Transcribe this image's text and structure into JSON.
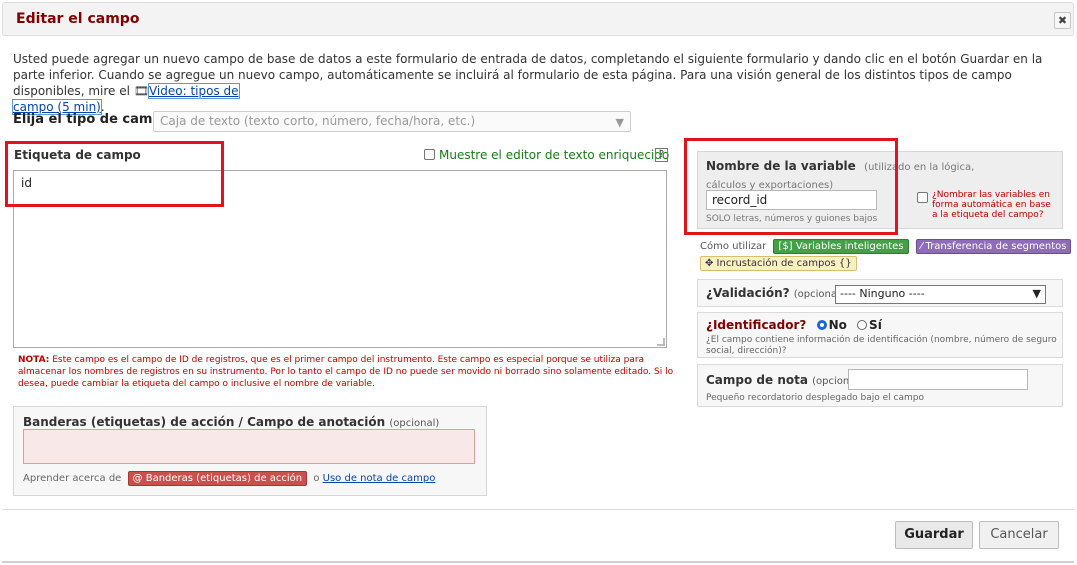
{
  "dialog": {
    "title": "Editar el campo",
    "close": "✖"
  },
  "intro": {
    "text1": "Usted puede agregar un nuevo campo de base de datos a este formulario de entrada de datos, completando el siguiente formulario y dando clic en el botón Guardar en la parte inferior. Cuando se agregue un nuevo campo, automáticamente se incluirá al formulario de esta página. Para una visión general de los distintos tipos de campo disponibles, mire el ",
    "video_link_a": "Video: tipos de",
    "video_link_b": "campo (5 min)",
    "video_icon": "film-icon"
  },
  "field_type": {
    "label": "Elija el tipo de campo",
    "selected": "Caja de texto (texto corto, número, fecha/hora, etc.)"
  },
  "field_label": {
    "label": "Etiqueta de campo",
    "rich_text_toggle": "Muestre el editor de texto enriquecido",
    "help": "?",
    "value": "id"
  },
  "note": {
    "prefix": "NOTA:",
    "text": " Este campo es el campo de ID de registros, que es el primer campo del instrumento. Este campo es especial porque se utiliza para almacenar los nombres de registros en su instrumento. Por lo tanto el campo de ID no puede ser movido ni borrado sino solamente editado. Si lo desea, puede cambiar la etiqueta del campo o inclusive el nombre de variable."
  },
  "action_tags": {
    "label": "Banderas (etiquetas) de acción / Campo de anotación",
    "optional": "(opcional)",
    "learn_prefix": "Aprender acerca de",
    "button": "@ Banderas (etiquetas) de acción",
    "or": "o",
    "link": "Uso de nota de campo"
  },
  "variable": {
    "label": "Nombre de la variable",
    "hint": "(utilizado en la lógica, cálculos y exportaciones)",
    "value": "record_id",
    "rule": "SOLO letras, números y guiones bajos",
    "auto_name": "¿Nombrar las variables en forma automática en base a la etiqueta del campo?"
  },
  "how_to": {
    "label": "Cómo utilizar",
    "smart_vars": "[$] Variables inteligentes",
    "piping": "⁄ Transferencia de segmentos",
    "embedding": "✥ Incrustación de campos {}"
  },
  "validation": {
    "label": "¿Validación?",
    "optional": "(opcional)",
    "selected": "---- Ninguno ----"
  },
  "identifier": {
    "label": "¿Identificador?",
    "no": "No",
    "yes": "Sí",
    "desc": "¿El campo contiene información de identificación (nombre, número de seguro social, dirección)?"
  },
  "field_note": {
    "label": "Campo de nota",
    "optional": "(opcional)",
    "desc": "Pequeño recordatorio desplegado bajo el campo"
  },
  "footer": {
    "save": "Guardar",
    "cancel": "Cancelar"
  },
  "colors": {
    "title": "#800000",
    "highlight": "#e0151c",
    "note": "#c00000"
  }
}
